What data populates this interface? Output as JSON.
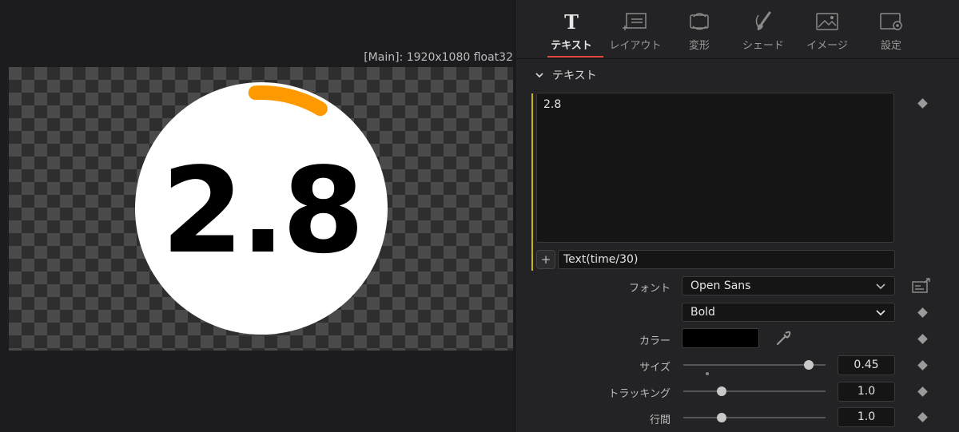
{
  "viewer": {
    "caption": "[Main]: 1920x1080 float32",
    "display_text": "2.8",
    "circle_color": "#ffffff",
    "arc_color": "#ff9900",
    "text_color": "#000000",
    "progress_arc_fraction": 0.093
  },
  "inspector": {
    "tabs": [
      {
        "label": "テキスト",
        "icon": "text-T-icon",
        "active": true
      },
      {
        "label": "レイアウト",
        "icon": "layout-icon",
        "active": false
      },
      {
        "label": "変形",
        "icon": "transform-icon",
        "active": false
      },
      {
        "label": "シェード",
        "icon": "shade-brush-icon",
        "active": false
      },
      {
        "label": "イメージ",
        "icon": "image-icon",
        "active": false
      },
      {
        "label": "設定",
        "icon": "settings-icon",
        "active": false
      }
    ],
    "section_title": "テキスト",
    "styled_text": "2.8",
    "expression": "Text(time/30)",
    "expression_add": "+",
    "font": {
      "label": "フォント",
      "family": "Open Sans",
      "style": "Bold"
    },
    "color": {
      "label": "カラー",
      "value": "#000000"
    },
    "size": {
      "label": "サイズ",
      "value": "0.45",
      "slider_fraction": 0.88
    },
    "tracking": {
      "label": "トラッキング",
      "value": "1.0",
      "slider_fraction": 0.27
    },
    "line_spacing": {
      "label": "行間",
      "value": "1.0",
      "slider_fraction": 0.27
    },
    "accent": "#e0463c"
  }
}
